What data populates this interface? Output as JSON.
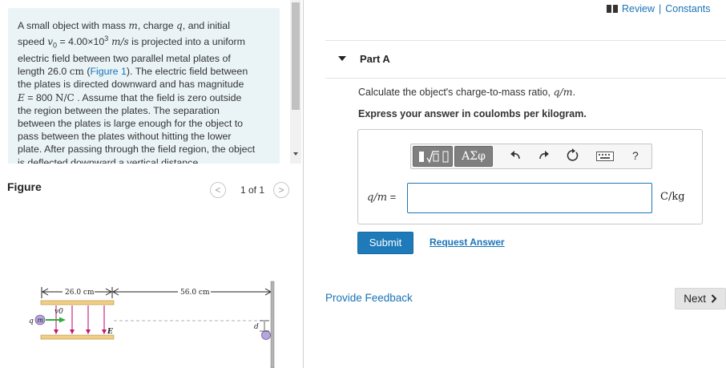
{
  "problem": {
    "t01": "A small object with mass ",
    "t02": "m",
    "t03": ", charge ",
    "t04": "q",
    "t05": ", and initial",
    "t06": "speed ",
    "t07": "v",
    "t08": "0",
    "t09": " = 4.00×10",
    "t10": "3",
    "t11": " m/s",
    "t12": " is projected into a uniform",
    "t13": "electric field between two parallel metal plates of",
    "t14": "length 26.0 ",
    "t15": "cm",
    "t16": " (",
    "t17": "Figure 1",
    "t18": "). The electric field between",
    "t19": "the plates is directed downward and has magnitude",
    "t20": "E",
    "t21": " = 800 ",
    "t22": "N/C",
    "t23": " . Assume that the field is zero outside",
    "t24": "the region between the plates. The separation",
    "t25": "between the plates is large enough for the object to",
    "t26": "pass between the plates without hitting the lower",
    "t27": "plate. After passing through the field region, the object",
    "t28": "is deflected downward a vertical distance"
  },
  "figure_panel": {
    "title": "Figure",
    "counter": "1 of 1",
    "prev_glyph": "<",
    "next_glyph": ">"
  },
  "figure": {
    "plate_length_label": "26.0 cm",
    "distance_label": "56.0 cm",
    "velocity_label": "v0",
    "field_label": "E",
    "charge_label": "q",
    "mass_label": "m",
    "deflection_label": "d"
  },
  "header": {
    "review_label": "Review",
    "separator": "|",
    "constants_label": "Constants"
  },
  "part": {
    "title": "Part A",
    "question_prefix": "Calculate the object's charge-to-mass ratio, ",
    "question_math": "q/m",
    "question_suffix": ".",
    "instruction": "Express your answer in coulombs per kilogram."
  },
  "toolbar": {
    "greek_label": "ΑΣφ",
    "help_label": "?"
  },
  "answer": {
    "label_math": "q/m",
    "label_eq": " =",
    "value": "",
    "unit": "C/kg"
  },
  "actions": {
    "submit_label": "Submit",
    "request_answer_label": "Request Answer"
  },
  "footer": {
    "feedback_label": "Provide Feedback",
    "next_label": "Next"
  }
}
